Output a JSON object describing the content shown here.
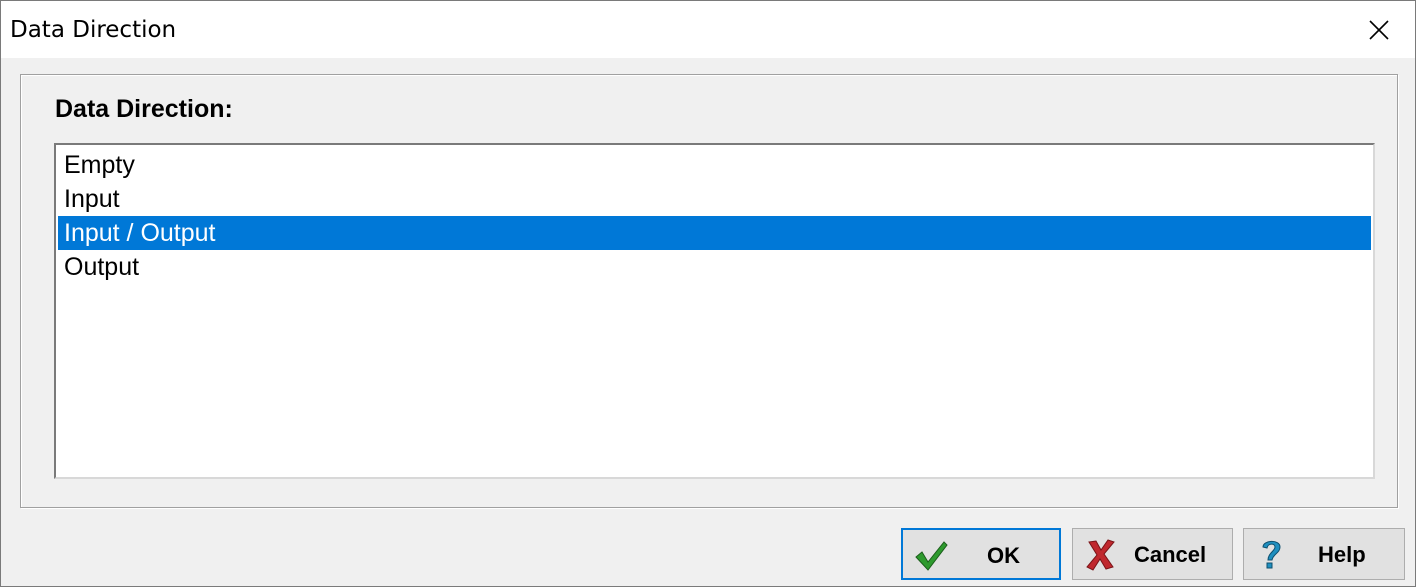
{
  "window": {
    "title": "Data Direction"
  },
  "group": {
    "label": "Data Direction:"
  },
  "list": {
    "items": [
      {
        "label": "Empty",
        "selected": false
      },
      {
        "label": "Input",
        "selected": false
      },
      {
        "label": "Input / Output",
        "selected": true
      },
      {
        "label": "Output",
        "selected": false
      }
    ]
  },
  "buttons": {
    "ok": {
      "label": "OK",
      "icon": "checkmark-icon"
    },
    "cancel": {
      "label": "Cancel",
      "icon": "red-x-icon"
    },
    "help": {
      "label": "Help",
      "icon": "question-mark-icon"
    }
  },
  "colors": {
    "selection": "#0078d7",
    "check": "#2e9a2e",
    "cancel_x": "#c0282e",
    "help_q": "#1f8fbf"
  }
}
